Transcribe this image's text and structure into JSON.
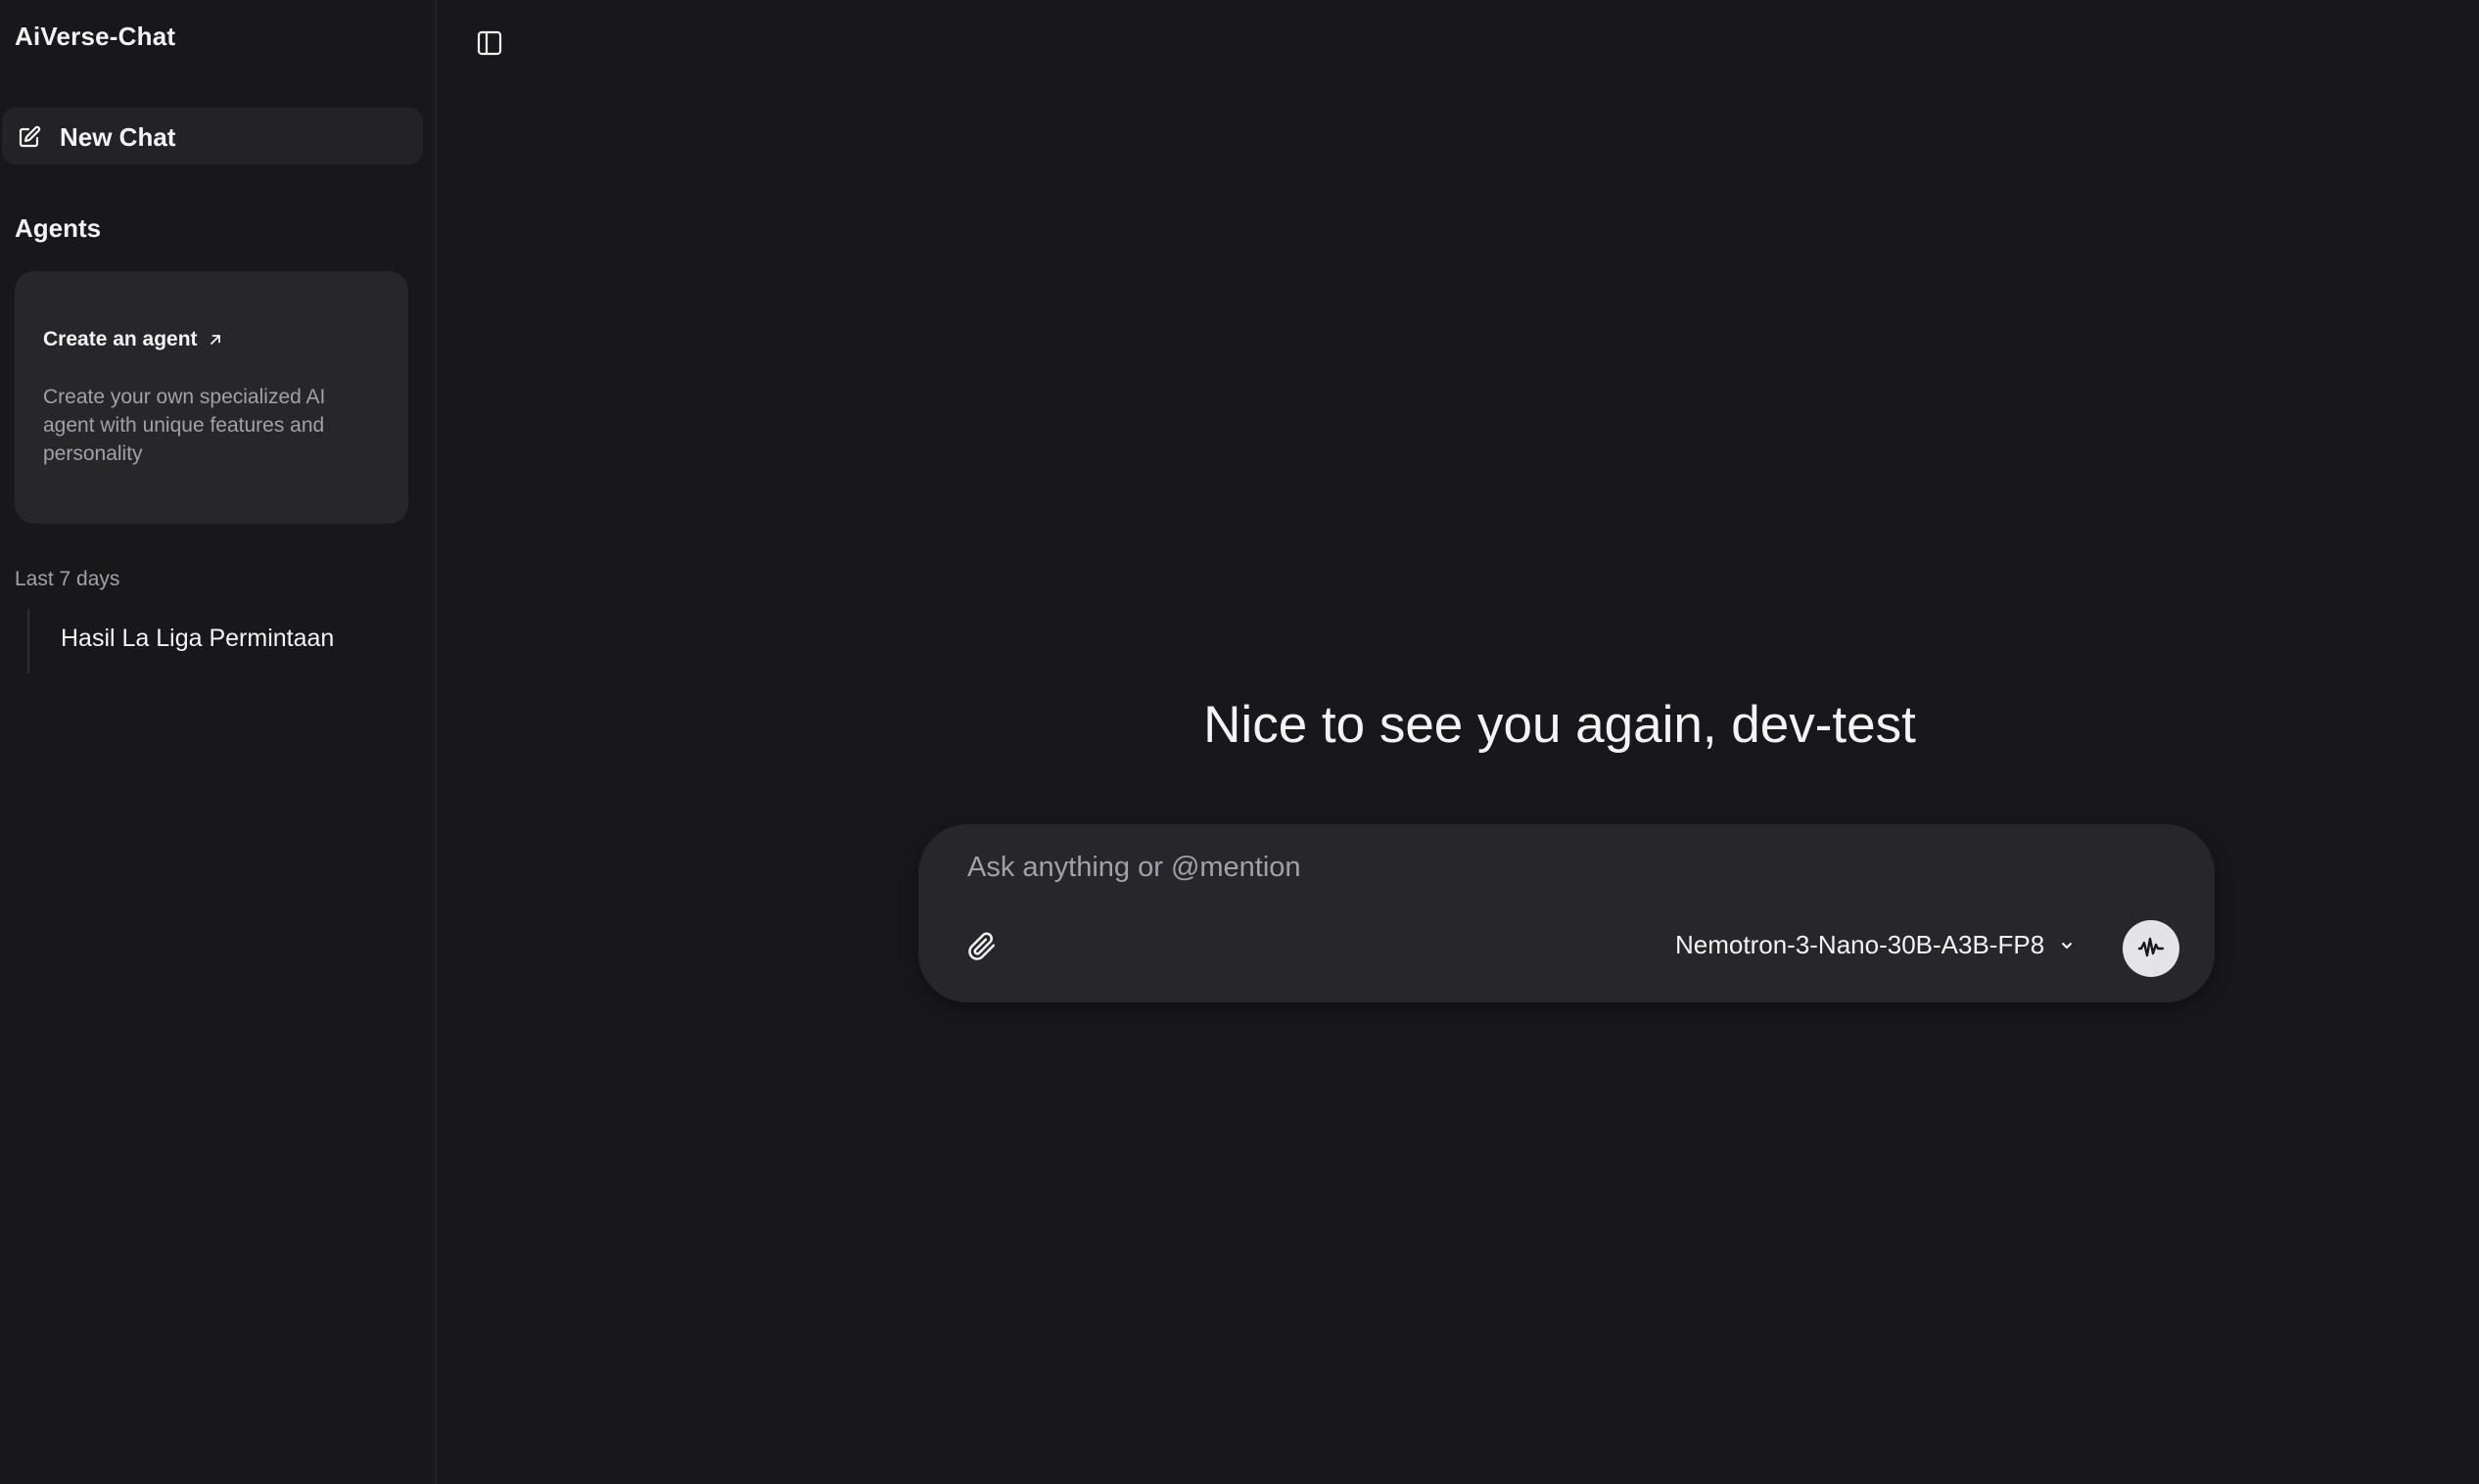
{
  "app": {
    "title": "AiVerse-Chat"
  },
  "sidebar": {
    "new_chat_label": "New Chat",
    "agents_title": "Agents",
    "agent_card": {
      "title": "Create an agent",
      "description": "Create your own specialized AI agent with unique features and personality"
    },
    "history": {
      "group_label": "Last 7 days",
      "items": [
        {
          "label": "Hasil La Liga Permintaan"
        }
      ]
    }
  },
  "main": {
    "greeting": "Nice to see you again, dev-test",
    "composer": {
      "placeholder": "Ask anything or @mention",
      "value": "",
      "model": "Nemotron-3-Nano-30B-A3B-FP8"
    }
  },
  "icons": {
    "new_chat": "edit-square-icon",
    "external_link": "arrow-up-right-icon",
    "toggle_sidebar": "sidebar-panel-icon",
    "attach": "paperclip-icon",
    "dropdown": "chevron-down-icon",
    "voice": "audio-waveform-icon"
  },
  "colors": {
    "background": "#18181b",
    "surface": "#27272a",
    "text": "#f4f4f5",
    "muted_text": "#a1a1aa",
    "voice_button": "#e4e4e7"
  }
}
